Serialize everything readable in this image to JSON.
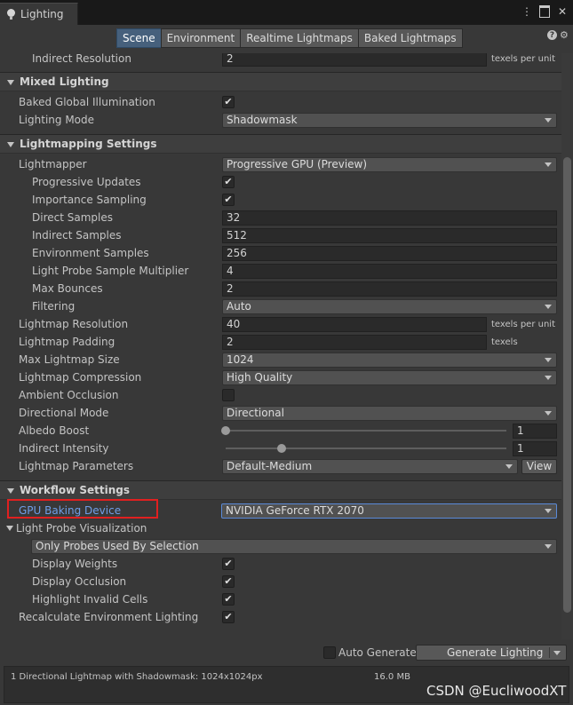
{
  "window": {
    "tab_title": "Lighting",
    "menu_glyph": "⋮",
    "close_glyph": "✕"
  },
  "toolbar": {
    "tabs": [
      "Scene",
      "Environment",
      "Realtime Lightmaps",
      "Baked Lightmaps"
    ],
    "active_tab": "Scene",
    "help_glyph": "?",
    "gear_glyph": "⚙"
  },
  "clipped_row": {
    "label": "Indirect Resolution",
    "value": "2",
    "unit": "texels per unit"
  },
  "mixed_lighting": {
    "title": "Mixed Lighting",
    "baked_gi": {
      "label": "Baked Global Illumination",
      "checked": true
    },
    "lighting_mode": {
      "label": "Lighting Mode",
      "value": "Shadowmask"
    }
  },
  "lightmapping": {
    "title": "Lightmapping Settings",
    "lightmapper": {
      "label": "Lightmapper",
      "value": "Progressive GPU (Preview)"
    },
    "progressive_updates": {
      "label": "Progressive Updates",
      "checked": true
    },
    "importance_sampling": {
      "label": "Importance Sampling",
      "checked": true
    },
    "direct_samples": {
      "label": "Direct Samples",
      "value": "32"
    },
    "indirect_samples": {
      "label": "Indirect Samples",
      "value": "512"
    },
    "environment_samples": {
      "label": "Environment Samples",
      "value": "256"
    },
    "light_probe_multiplier": {
      "label": "Light Probe Sample Multiplier",
      "value": "4"
    },
    "max_bounces": {
      "label": "Max Bounces",
      "value": "2"
    },
    "filtering": {
      "label": "Filtering",
      "value": "Auto"
    },
    "lightmap_resolution": {
      "label": "Lightmap Resolution",
      "value": "40",
      "unit": "texels per unit"
    },
    "lightmap_padding": {
      "label": "Lightmap Padding",
      "value": "2",
      "unit": "texels"
    },
    "max_lightmap_size": {
      "label": "Max Lightmap Size",
      "value": "1024"
    },
    "lightmap_compression": {
      "label": "Lightmap Compression",
      "value": "High Quality"
    },
    "ambient_occlusion": {
      "label": "Ambient Occlusion",
      "checked": false
    },
    "directional_mode": {
      "label": "Directional Mode",
      "value": "Directional"
    },
    "albedo_boost": {
      "label": "Albedo Boost",
      "value": "1",
      "slider_min": 1,
      "slider_max": 10,
      "slider_value": 1
    },
    "indirect_intensity": {
      "label": "Indirect Intensity",
      "value": "1",
      "slider_min": 0,
      "slider_max": 5,
      "slider_value": 1
    },
    "lightmap_parameters": {
      "label": "Lightmap Parameters",
      "value": "Default-Medium",
      "view_label": "View"
    }
  },
  "workflow": {
    "title": "Workflow Settings",
    "gpu_device": {
      "label": "GPU Baking Device",
      "value": "NVIDIA GeForce RTX 2070"
    },
    "probe_vis": {
      "label": "Light Probe Visualization",
      "value": "Only Probes Used By Selection"
    },
    "display_weights": {
      "label": "Display Weights",
      "checked": true
    },
    "display_occlusion": {
      "label": "Display Occlusion",
      "checked": true
    },
    "highlight_invalid": {
      "label": "Highlight Invalid Cells",
      "checked": true
    },
    "recalc_env": {
      "label": "Recalculate Environment Lighting",
      "checked": true
    }
  },
  "footer": {
    "auto_generate": "Auto Generate",
    "generate_lighting": "Generate Lighting"
  },
  "status": {
    "summary": "1 Directional Lightmap with Shadowmask: 1024x1024px",
    "size": "16.0 MB",
    "watermark": "CSDN @EucliwoodXT"
  },
  "colors": {
    "background": "#383838",
    "active_tab": "#46607c",
    "highlight": "#e02020",
    "link_blue": "#6f9ee8"
  }
}
